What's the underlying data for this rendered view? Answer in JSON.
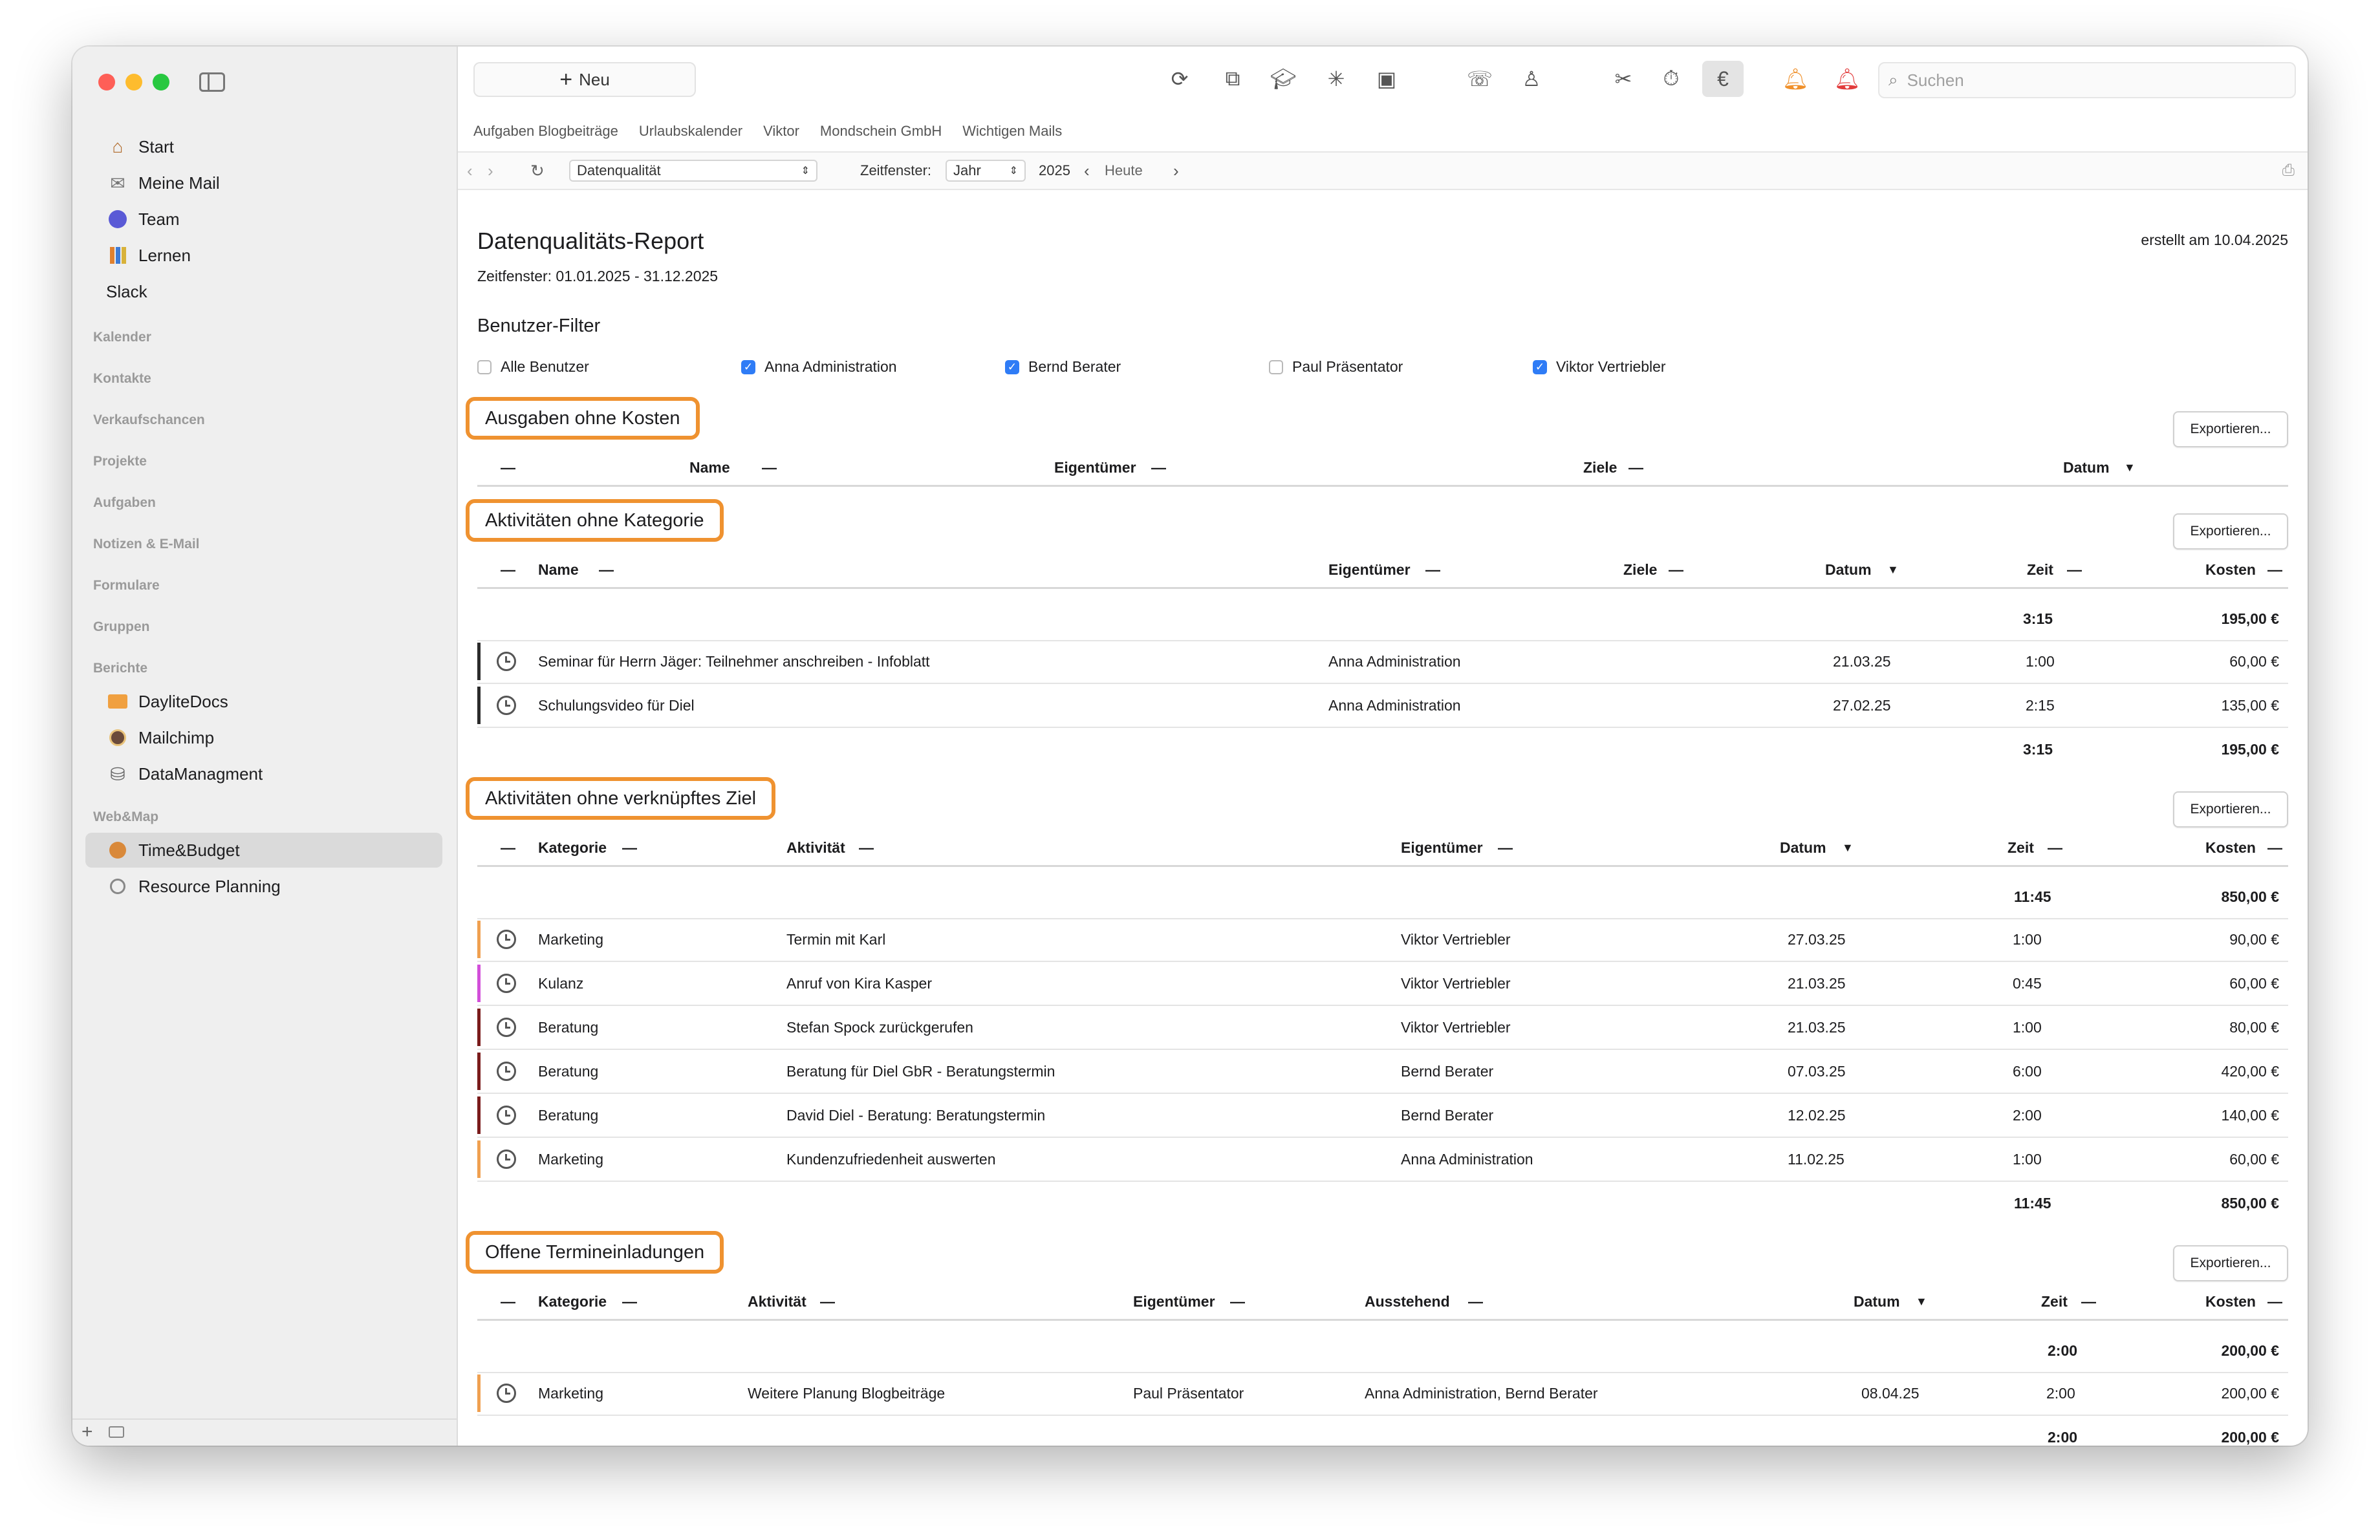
{
  "sidebar": {
    "items": [
      {
        "label": "Start",
        "icon": "home-icon"
      },
      {
        "label": "Meine Mail",
        "icon": "mail-icon"
      },
      {
        "label": "Team",
        "icon": "team-icon"
      },
      {
        "label": "Lernen",
        "icon": "books-icon"
      },
      {
        "label": "Slack",
        "icon": ""
      }
    ],
    "sections": [
      "Kalender",
      "Kontakte",
      "Verkaufschancen",
      "Projekte",
      "Aufgaben",
      "Notizen & E-Mail",
      "Formulare",
      "Gruppen",
      "Berichte"
    ],
    "reports": [
      {
        "label": "DayliteDocs",
        "icon": "folder-icon"
      },
      {
        "label": "Mailchimp",
        "icon": "mailchimp-icon"
      },
      {
        "label": "DataManagment",
        "icon": "database-icon"
      }
    ],
    "webmap_heading": "Web&Map",
    "webmap": [
      {
        "label": "Time&Budget",
        "icon": "clock-badge-icon"
      },
      {
        "label": "Resource Planning",
        "icon": "resource-icon"
      }
    ]
  },
  "toolbar": {
    "new_label": "Neu",
    "search_placeholder": "Suchen"
  },
  "favorites": [
    "Aufgaben Blogbeiträge",
    "Urlaubskalender",
    "Viktor",
    "Mondschein GmbH",
    "Wichtigen Mails"
  ],
  "nav": {
    "report_select": "Datenqualität",
    "timeframe_label": "Zeitfenster:",
    "timeframe_select": "Jahr",
    "year": "2025",
    "today": "Heute"
  },
  "report": {
    "title": "Datenqualitäts-Report",
    "created": "erstellt am 10.04.2025",
    "timeframe": "Zeitfenster: 01.01.2025 - 31.12.2025",
    "filter_title": "Benutzer-Filter",
    "filters": [
      {
        "label": "Alle Benutzer",
        "checked": false
      },
      {
        "label": "Anna Administration",
        "checked": true
      },
      {
        "label": "Bernd Berater",
        "checked": true
      },
      {
        "label": "Paul Präsentator",
        "checked": false
      },
      {
        "label": "Viktor Vertriebler",
        "checked": true
      }
    ],
    "export_label": "Exportieren...",
    "dash": "—",
    "sort_arrow": "▼",
    "s1": {
      "title": "Ausgaben ohne Kosten",
      "cols": {
        "name": "Name",
        "owner": "Eigentümer",
        "goals": "Ziele",
        "date": "Datum"
      }
    },
    "s2": {
      "title": "Aktivitäten ohne Kategorie",
      "cols": {
        "name": "Name",
        "owner": "Eigentümer",
        "goals": "Ziele",
        "date": "Datum",
        "time": "Zeit",
        "cost": "Kosten"
      },
      "total_time": "3:15",
      "total_cost": "195,00 €",
      "rows": [
        {
          "name": "Seminar für Herrn Jäger: Teilnehmer anschreiben - Infoblatt",
          "owner": "Anna Administration",
          "date": "21.03.25",
          "time": "1:00",
          "cost": "60,00 €",
          "color": "#2b2b2b"
        },
        {
          "name": "Schulungsvideo für Diel",
          "owner": "Anna Administration",
          "date": "27.02.25",
          "time": "2:15",
          "cost": "135,00 €",
          "color": "#2b2b2b"
        }
      ]
    },
    "s3": {
      "title": "Aktivitäten ohne verknüpftes Ziel",
      "cols": {
        "category": "Kategorie",
        "activity": "Aktivität",
        "owner": "Eigentümer",
        "date": "Datum",
        "time": "Zeit",
        "cost": "Kosten"
      },
      "total_time": "11:45",
      "total_cost": "850,00 €",
      "rows": [
        {
          "category": "Marketing",
          "activity": "Termin mit Karl",
          "owner": "Viktor Vertriebler",
          "date": "27.03.25",
          "time": "1:00",
          "cost": "90,00 €",
          "color": "#f0a050"
        },
        {
          "category": "Kulanz",
          "activity": "Anruf von Kira Kasper",
          "owner": "Viktor Vertriebler",
          "date": "21.03.25",
          "time": "0:45",
          "cost": "60,00 €",
          "color": "#d24fd9"
        },
        {
          "category": "Beratung",
          "activity": "Stefan Spock zurückgerufen",
          "owner": "Viktor Vertriebler",
          "date": "21.03.25",
          "time": "1:00",
          "cost": "80,00 €",
          "color": "#7a1c1c"
        },
        {
          "category": "Beratung",
          "activity": "Beratung für Diel GbR - Beratungstermin",
          "owner": "Bernd Berater",
          "date": "07.03.25",
          "time": "6:00",
          "cost": "420,00 €",
          "color": "#7a1c1c"
        },
        {
          "category": "Beratung",
          "activity": "David Diel - Beratung: Beratungstermin",
          "owner": "Bernd Berater",
          "date": "12.02.25",
          "time": "2:00",
          "cost": "140,00 €",
          "color": "#7a1c1c"
        },
        {
          "category": "Marketing",
          "activity": "Kundenzufriedenheit auswerten",
          "owner": "Anna Administration",
          "date": "11.02.25",
          "time": "1:00",
          "cost": "60,00 €",
          "color": "#f0a050"
        }
      ]
    },
    "s4": {
      "title": "Offene Termineinladungen",
      "cols": {
        "category": "Kategorie",
        "activity": "Aktivität",
        "owner": "Eigentümer",
        "pending": "Ausstehend",
        "date": "Datum",
        "time": "Zeit",
        "cost": "Kosten"
      },
      "total_time": "2:00",
      "total_cost": "200,00 €",
      "rows": [
        {
          "category": "Marketing",
          "activity": "Weitere Planung Blogbeiträge",
          "owner": "Paul Präsentator",
          "pending": "Anna Administration, Bernd Berater",
          "date": "08.04.25",
          "time": "2:00",
          "cost": "200,00 €",
          "color": "#f0a050"
        }
      ]
    }
  }
}
